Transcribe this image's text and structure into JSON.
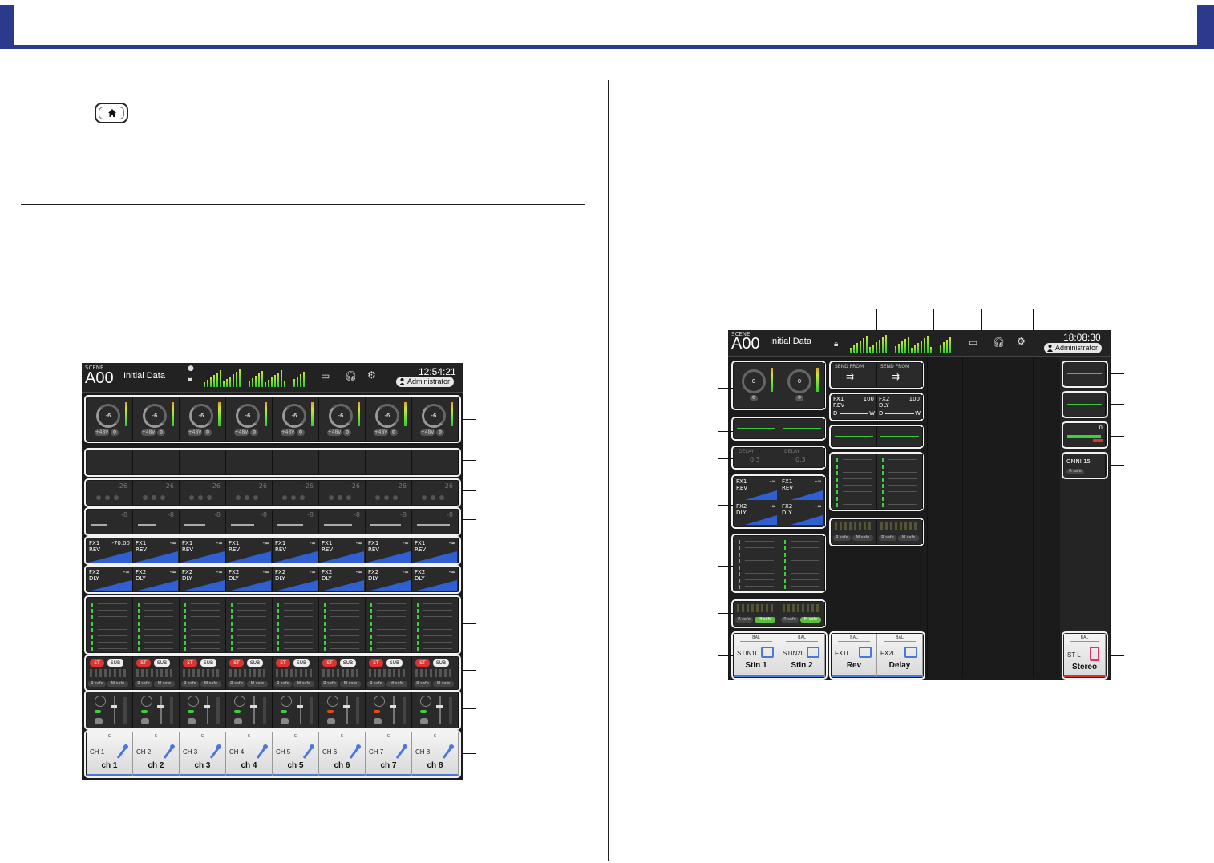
{
  "screen_left": {
    "scene_label": "SCENE",
    "scene_number": "A00",
    "scene_name": "Initial Data",
    "clock": "12:54:21",
    "user": "Administrator",
    "gain_values": [
      "-6",
      "-6",
      "-6",
      "-6",
      "-6",
      "-6",
      "-6",
      "-6"
    ],
    "phantom_label": "+48V",
    "phase_label": "Φ",
    "gate_values": [
      "-26",
      "-26",
      "-26",
      "-26",
      "-26",
      "-26",
      "-26",
      "-26"
    ],
    "comp_values": [
      "-8",
      "-8",
      "-8",
      "-8",
      "-8",
      "-8",
      "-8",
      "-8"
    ],
    "fx1_label": "FX1",
    "fx1_type": "REV",
    "fx1_values": [
      "-70.00",
      "-∞",
      "-∞",
      "-∞",
      "-∞",
      "-∞",
      "-∞",
      "-∞"
    ],
    "fx2_label": "FX2",
    "fx2_type": "DLY",
    "fx2_values": [
      "-∞",
      "-∞",
      "-∞",
      "-∞",
      "-∞",
      "-∞",
      "-∞",
      "-∞"
    ],
    "st_label": "ST",
    "sub_label": "SUB",
    "rsafe_label": "R safe",
    "msafe_label": "M safe",
    "bal_label": "C",
    "channels": [
      {
        "id": "CH 1",
        "name": "ch 1"
      },
      {
        "id": "CH 2",
        "name": "ch 2"
      },
      {
        "id": "CH 3",
        "name": "ch 3"
      },
      {
        "id": "CH 4",
        "name": "ch 4"
      },
      {
        "id": "CH 5",
        "name": "ch 5"
      },
      {
        "id": "CH 6",
        "name": "ch 6"
      },
      {
        "id": "CH 7",
        "name": "ch 7"
      },
      {
        "id": "CH 8",
        "name": "ch 8"
      }
    ],
    "colors": {
      "ch_underline": "#4a78d8",
      "st_button": "#d33333",
      "led_on_green": "#3ad13a",
      "led_on_red": "#e04a20"
    }
  },
  "screen_right": {
    "scene_label": "SCENE",
    "scene_number": "A00",
    "scene_name": "Initial Data",
    "clock": "18:08:30",
    "user": "Administrator",
    "gain_values": [
      "0",
      "0"
    ],
    "phase_label": "Φ",
    "send_from_label": "SEND FROM",
    "fx_rtn": [
      {
        "label": "FX1",
        "value": "100",
        "type": "REV",
        "d": "D",
        "w": "W"
      },
      {
        "label": "FX2",
        "value": "100",
        "type": "DLY",
        "d": "D",
        "w": "W"
      }
    ],
    "delay_label": "DELAY",
    "delay_values": [
      "0.3",
      "0.3"
    ],
    "fx1_label": "FX1",
    "fx1_type": "REV",
    "fx1_values": [
      "-∞",
      "-∞"
    ],
    "fx2_label": "FX2",
    "fx2_type": "DLY",
    "fx2_values": [
      "-∞",
      "-∞"
    ],
    "rsafe_label": "R safe",
    "msafe_label": "M safe",
    "bal_label": "BAL",
    "stin_channels": [
      {
        "id": "STIN1L",
        "name": "StIn 1"
      },
      {
        "id": "STIN2L",
        "name": "StIn 2"
      }
    ],
    "fx_channels": [
      {
        "id": "FX1L",
        "name": "Rev"
      },
      {
        "id": "FX2L",
        "name": "Delay"
      }
    ],
    "master_channel": {
      "id": "ST L",
      "name": "Stereo"
    },
    "master_meter_value": "0",
    "omni_label": "OMNI 15",
    "colors": {
      "stin_underline": "#4a78d8",
      "master_underline": "#d33333"
    }
  }
}
